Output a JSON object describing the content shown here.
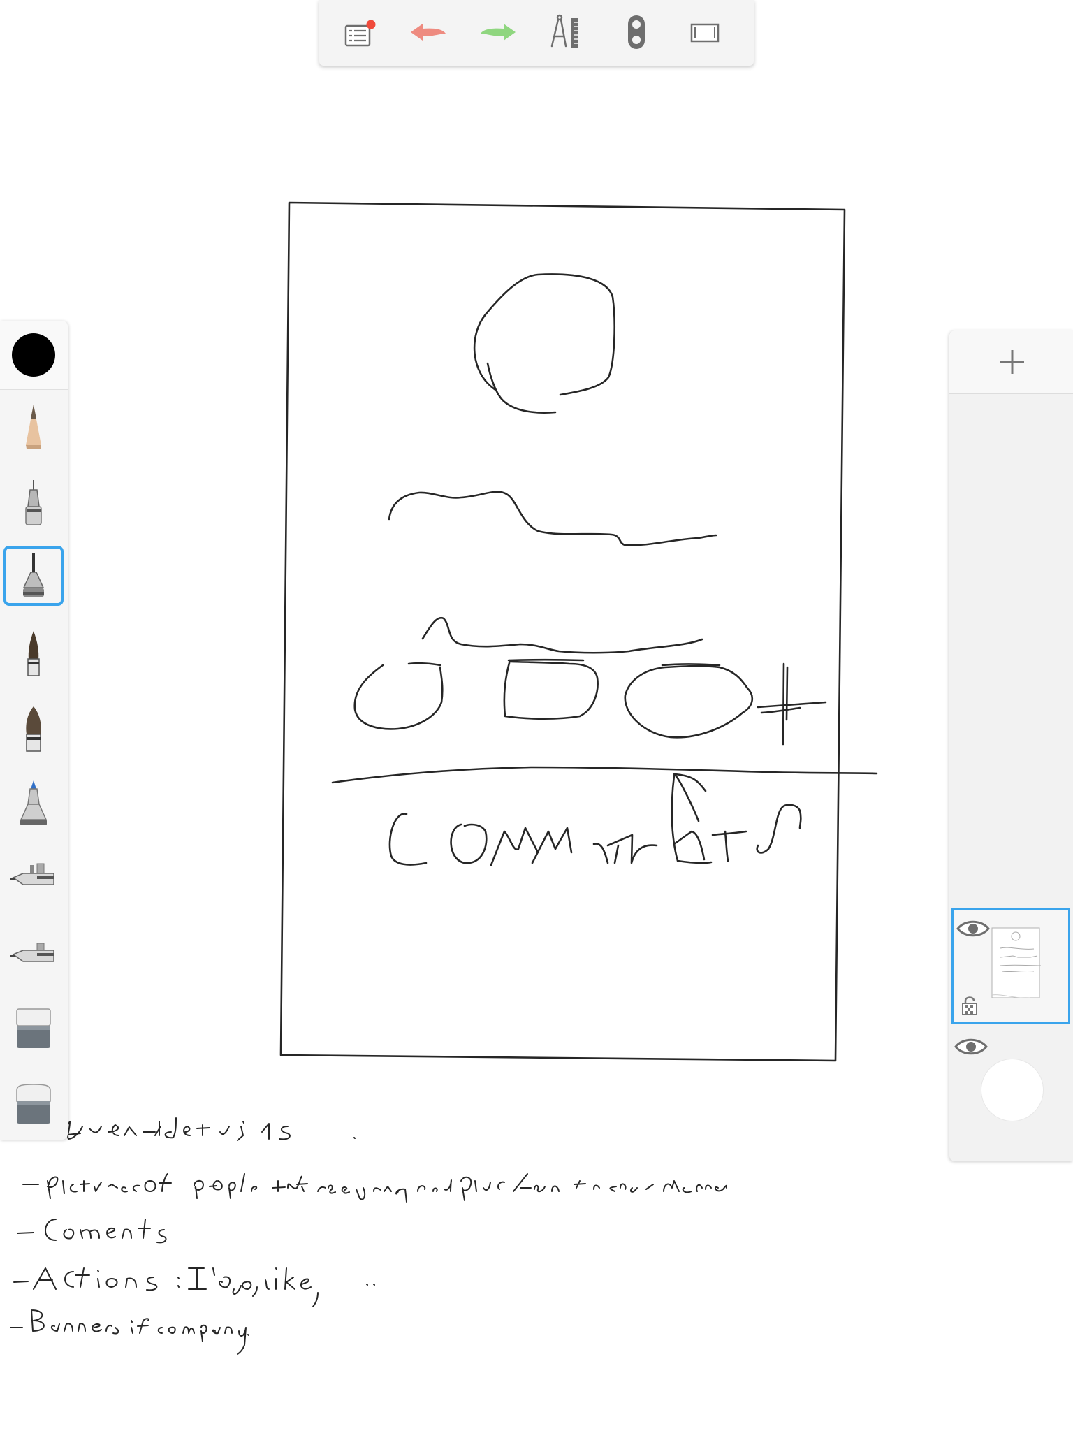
{
  "toolbar": {
    "buttons": [
      {
        "name": "menu",
        "icon": "list-menu-icon",
        "has_notification_dot": true
      },
      {
        "name": "undo",
        "icon": "undo-arrow-icon",
        "color": "#ee8b80"
      },
      {
        "name": "redo",
        "icon": "redo-arrow-icon",
        "color": "#8fd67f"
      },
      {
        "name": "guides",
        "icon": "compass-ruler-icon"
      },
      {
        "name": "symmetry",
        "icon": "symmetry-toggle-icon"
      },
      {
        "name": "canvas",
        "icon": "canvas-frame-icon"
      }
    ],
    "notification_color": "#f04a3b"
  },
  "brush_palette": {
    "current_color": "#000000",
    "selected_brush": "ballpoint",
    "brushes": [
      {
        "name": "pencil",
        "icon": "pencil-brush-icon"
      },
      {
        "name": "technical-pen",
        "icon": "technical-pen-brush-icon"
      },
      {
        "name": "ballpoint",
        "icon": "ballpoint-brush-icon"
      },
      {
        "name": "paintbrush",
        "icon": "paintbrush-brush-icon"
      },
      {
        "name": "flat-brush",
        "icon": "flat-brush-icon"
      },
      {
        "name": "marker",
        "icon": "marker-brush-icon"
      },
      {
        "name": "airbrush",
        "icon": "airbrush-icon"
      },
      {
        "name": "airbrush-2",
        "icon": "airbrush-2-icon"
      },
      {
        "name": "soft-eraser",
        "icon": "soft-eraser-icon"
      },
      {
        "name": "hard-eraser",
        "icon": "hard-eraser-icon"
      }
    ]
  },
  "layers_panel": {
    "add_button": "add-layer-icon",
    "layers": [
      {
        "name": "layer-1",
        "visible": true,
        "locked": false,
        "selected": true
      },
      {
        "name": "background",
        "visible": true,
        "selected": false
      }
    ],
    "accent": "#3aa4ec"
  }
}
